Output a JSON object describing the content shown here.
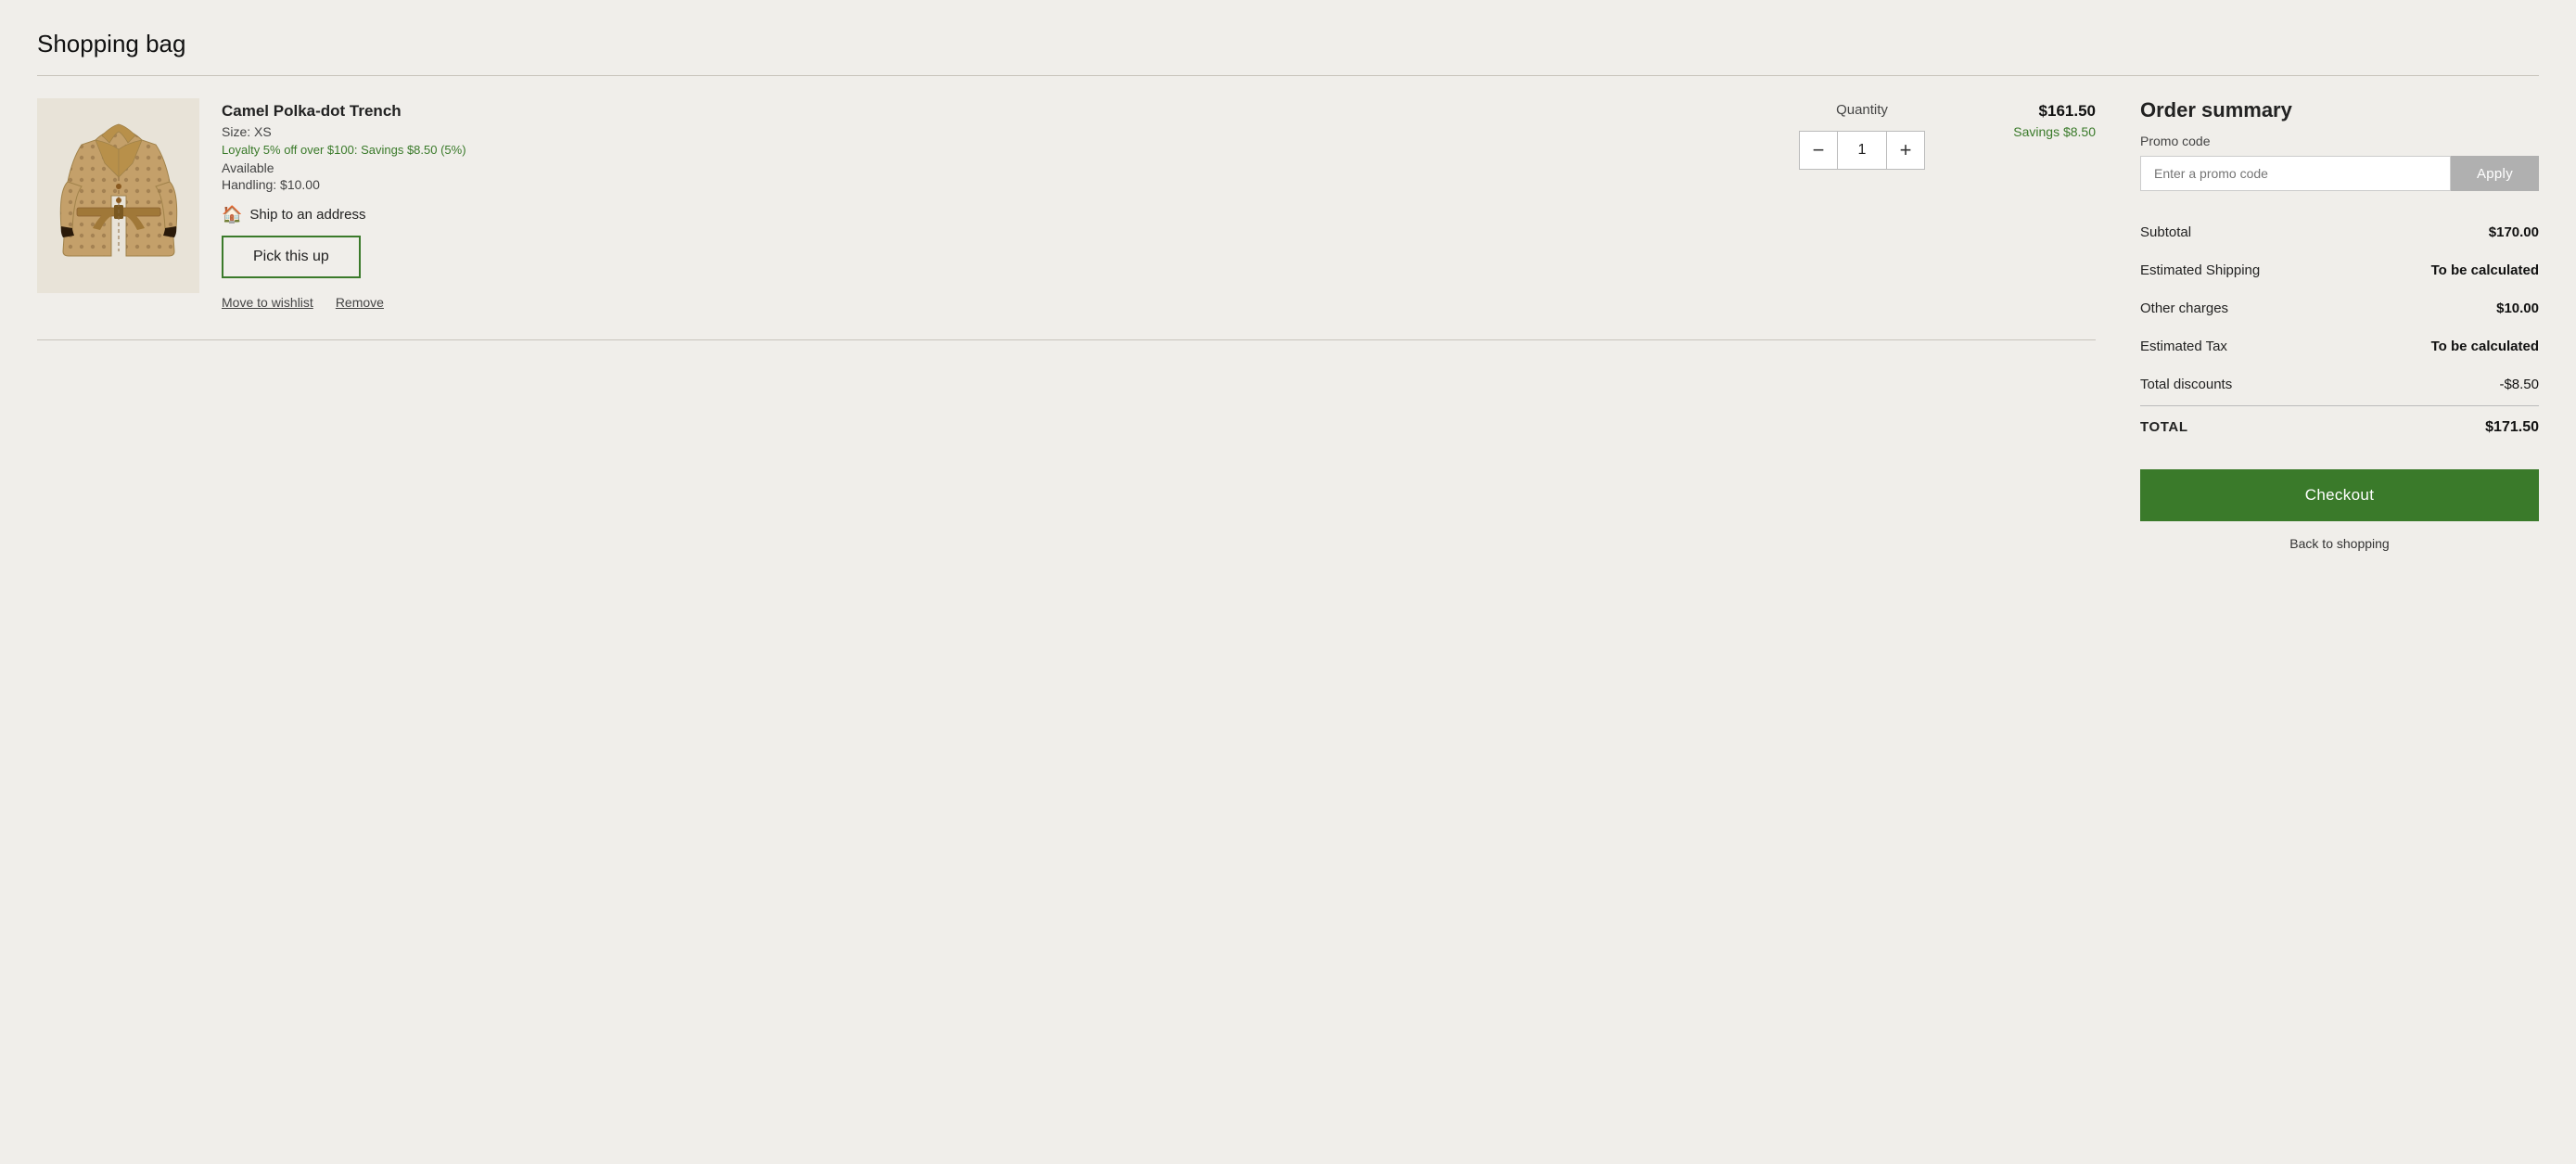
{
  "page": {
    "title": "Shopping bag"
  },
  "cart": {
    "item": {
      "name": "Camel Polka-dot Trench",
      "size_label": "Size: XS",
      "loyalty_text": "Loyalty 5% off over $100: Savings $8.50 (5%)",
      "available_text": "Available",
      "handling_text": "Handling: $10.00",
      "ship_label": "Ship to an address",
      "pickup_label": "Pick this up",
      "move_wishlist_label": "Move to wishlist",
      "remove_label": "Remove",
      "quantity_label": "Quantity",
      "quantity_value": "1",
      "qty_minus": "−",
      "qty_plus": "+",
      "price": "$161.50",
      "savings": "Savings $8.50"
    }
  },
  "order_summary": {
    "title": "Order summary",
    "promo_label": "Promo code",
    "promo_placeholder": "Enter a promo code",
    "apply_label": "Apply",
    "rows": [
      {
        "label": "Subtotal",
        "value": "$170.00",
        "bold": true
      },
      {
        "label": "Estimated Shipping",
        "value": "To be calculated",
        "bold": true
      },
      {
        "label": "Other charges",
        "value": "$10.00",
        "bold": true
      },
      {
        "label": "Estimated Tax",
        "value": "To be calculated",
        "bold": true
      },
      {
        "label": "Total discounts",
        "value": "-$8.50",
        "bold": false
      }
    ],
    "total_label": "TOTAL",
    "total_value": "$171.50",
    "checkout_label": "Checkout",
    "back_label": "Back to shopping"
  }
}
